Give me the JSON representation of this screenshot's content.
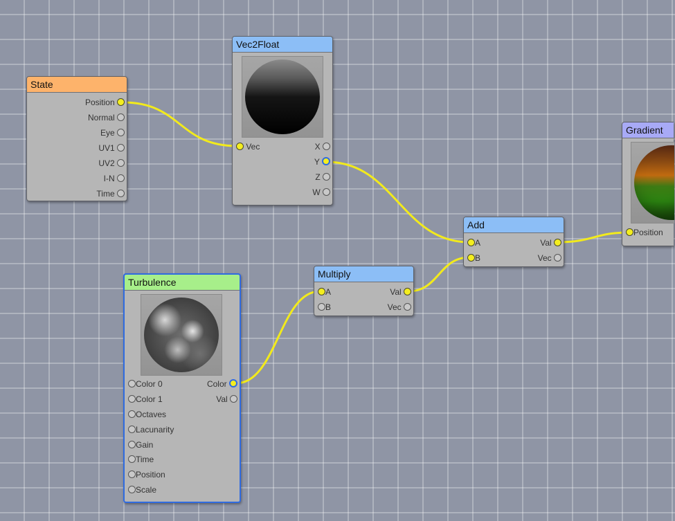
{
  "nodes": {
    "state": {
      "title": "State",
      "color": "#fdb36b",
      "outputs": [
        "Position",
        "Normal",
        "Eye",
        "UV1",
        "UV2",
        "I-N",
        "Time"
      ]
    },
    "vec2float": {
      "title": "Vec2Float",
      "color": "#8cbef6",
      "input": "Vec",
      "outputs": [
        "X",
        "Y",
        "Z",
        "W"
      ]
    },
    "add": {
      "title": "Add",
      "color": "#8cbef6",
      "inputs": [
        "A",
        "B"
      ],
      "outputs": [
        "Val",
        "Vec"
      ]
    },
    "multiply": {
      "title": "Multiply",
      "color": "#8cbef6",
      "inputs": [
        "A",
        "B"
      ],
      "outputs": [
        "Val",
        "Vec"
      ]
    },
    "turbulence": {
      "title": "Turbulence",
      "color": "#a7ef8a",
      "inputs": [
        "Color 0",
        "Color 1",
        "Octaves",
        "Lacunarity",
        "Gain",
        "Time",
        "Position",
        "Scale"
      ],
      "outputs": [
        "Color",
        "Val"
      ]
    },
    "gradient": {
      "title": "Gradient",
      "color": "#a8aaf6",
      "input": "Position"
    }
  },
  "colors": {
    "wire": "#f2ea1c",
    "selection": "#2f6be0",
    "canvas": "#8f95a5"
  }
}
